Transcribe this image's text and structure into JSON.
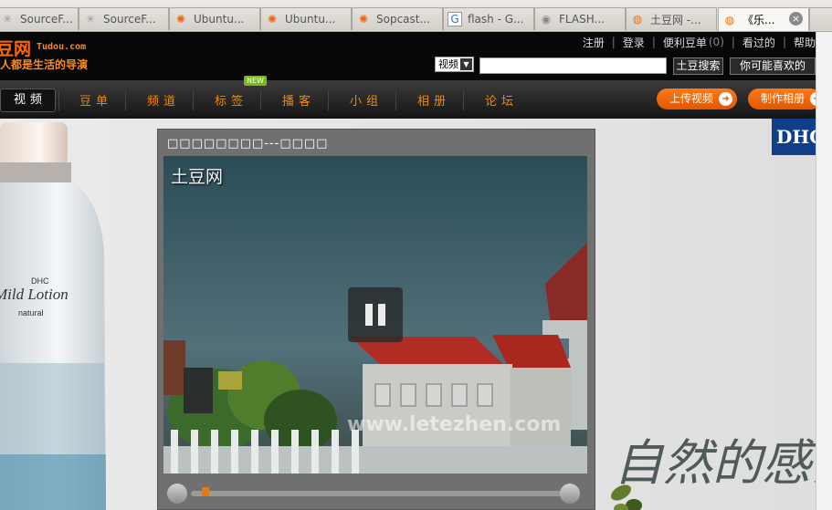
{
  "browser": {
    "tabs": [
      {
        "label": "SourceF...",
        "icon": "sourceforge-icon"
      },
      {
        "label": "SourceF...",
        "icon": "sourceforge-icon"
      },
      {
        "label": "Ubuntu...",
        "icon": "ubuntu-icon"
      },
      {
        "label": "Ubuntu...",
        "icon": "ubuntu-icon"
      },
      {
        "label": "Sopcast...",
        "icon": "ubuntu-icon"
      },
      {
        "label": "flash - G...",
        "icon": "google-icon"
      },
      {
        "label": "FLASH...",
        "icon": "globe-icon"
      },
      {
        "label": "土豆网 -...",
        "icon": "tudou-icon"
      },
      {
        "label": "《乐...",
        "icon": "tudou-icon",
        "active": true
      }
    ]
  },
  "header": {
    "logo_main": "豆网",
    "logo_latin": "Tudou.com",
    "slogan": "人都是生活的导演",
    "toplinks": {
      "register": "注册",
      "login": "登录",
      "bean": "便利豆单",
      "bean_count": "(0)",
      "watched": "看过的",
      "help": "帮助"
    },
    "search": {
      "type": "视频",
      "query": "",
      "button": "土豆搜索",
      "recommend": "你可能喜欢的"
    }
  },
  "nav": {
    "items": [
      "视频",
      "豆单",
      "频道",
      "标签",
      "播客",
      "小组",
      "相册",
      "论坛"
    ],
    "active_index": 0,
    "new_badge": "NEW",
    "upload": "上传视频",
    "make_album": "制作相册"
  },
  "player": {
    "title": "□□□□□□□□---□□□□",
    "logo_watermark": "土豆网",
    "site_watermark": "www.letezhen.com",
    "progress": 0.03
  },
  "ads": {
    "dhc_logo": "DHC",
    "bottle_brand": "DHC",
    "bottle_product": "Mild Lotion",
    "bottle_sub": "natural",
    "slogan": "自然的感觉"
  },
  "colors": {
    "accent": "#ff6a00",
    "nav_text": "#f28a00",
    "new_badge": "#78b81a",
    "dhc_blue": "#0f3e8a"
  }
}
